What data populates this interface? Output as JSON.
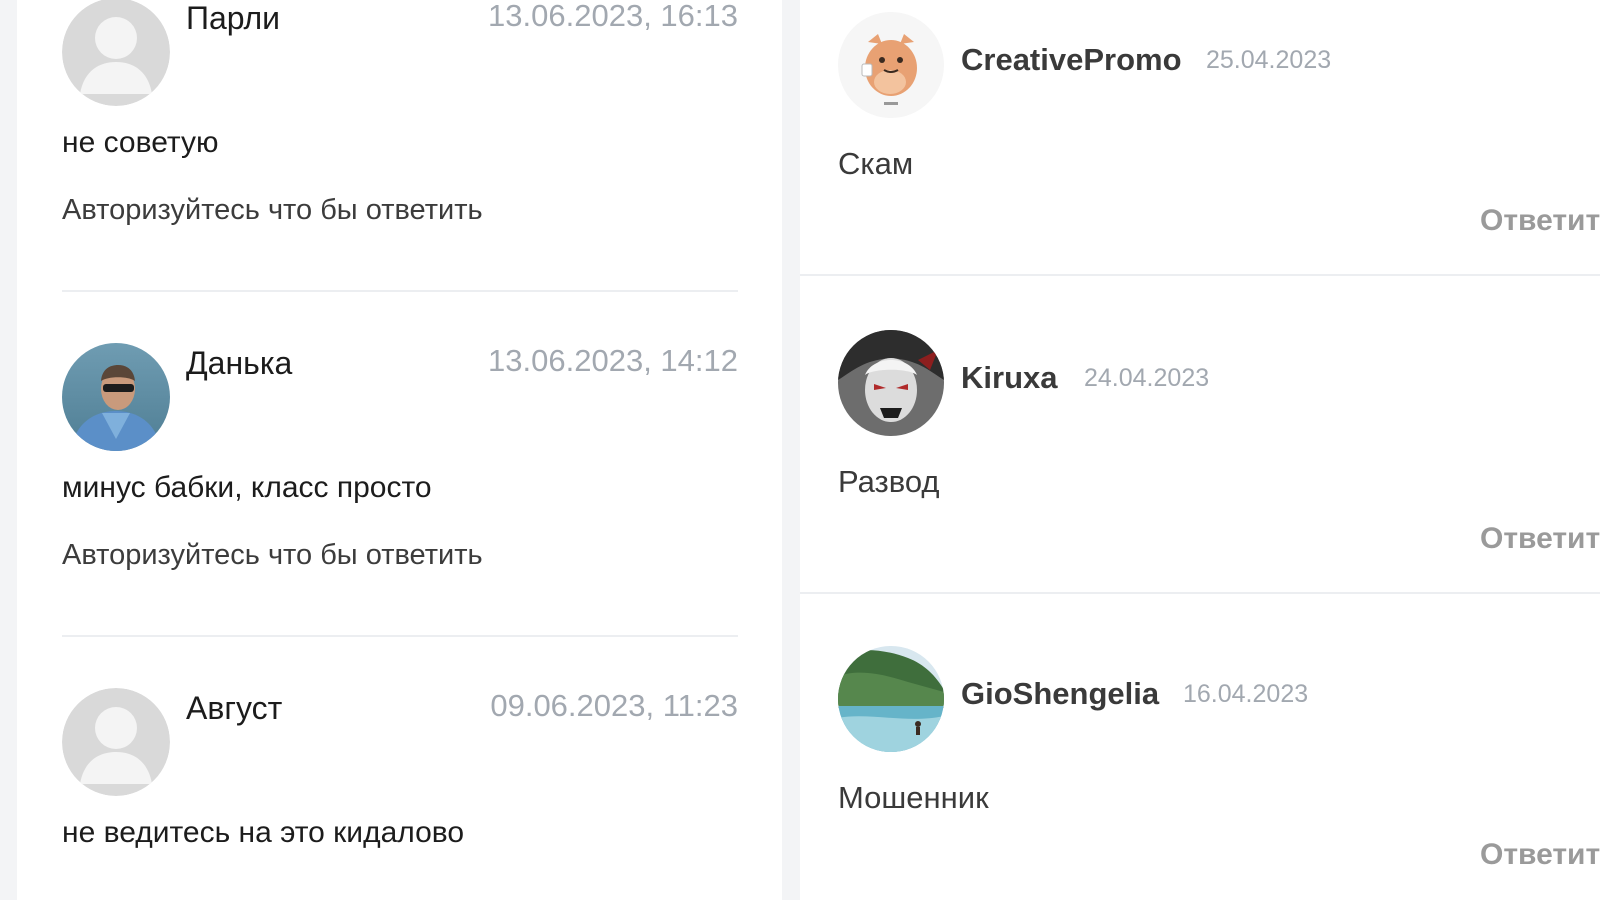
{
  "left_comments": [
    {
      "author": "Парли",
      "date": "13.06.2023, 16:13",
      "text": "не советую",
      "reply_hint": "Авторизуйтесь что бы ответить",
      "avatar": "default-user-icon"
    },
    {
      "author": "Данька",
      "date": "13.06.2023, 14:12",
      "text": "минус бабки, класс просто",
      "reply_hint": "Авторизуйтесь что бы ответить",
      "avatar": "user-photo"
    },
    {
      "author": "Август",
      "date": "09.06.2023, 11:23",
      "text": "не ведитесь на это кидалово",
      "avatar": "default-user-icon"
    }
  ],
  "right_comments": [
    {
      "author": "CreativePromo",
      "date": "25.04.2023",
      "text": "Скам",
      "reply_label": "Ответить",
      "avatar": "cartoon-creature-image"
    },
    {
      "author": "Kiruxa",
      "date": "24.04.2023",
      "text": "Развод",
      "reply_label": "Ответить",
      "avatar": "anime-character-image"
    },
    {
      "author": "GioShengelia",
      "date": "16.04.2023",
      "text": "Мошенник",
      "reply_label": "Ответить",
      "avatar": "seaside-photo"
    }
  ],
  "colors": {
    "page_background": "#f3f4f6",
    "card_background": "#ffffff",
    "date_text": "#a2a8b0",
    "reply_button": "#9a9a9a",
    "author_text": "#1c1c1c"
  }
}
